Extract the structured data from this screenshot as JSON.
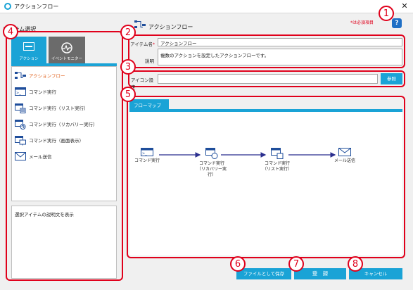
{
  "window": {
    "title": "アクションフロー"
  },
  "required_note": "*は必須項目",
  "help": {
    "label": "?"
  },
  "left": {
    "section_title": "アイテム選択",
    "tabs": [
      {
        "label": "アクション"
      },
      {
        "label": "イベントモニター"
      }
    ],
    "items": [
      {
        "label": "アクションフロー",
        "icon": "action-flow-icon"
      },
      {
        "label": "コマンド実行",
        "icon": "command-icon"
      },
      {
        "label": "コマンド実行（リスト実行）",
        "icon": "command-list-icon"
      },
      {
        "label": "コマンド実行（リカバリー実行）",
        "icon": "command-recovery-icon"
      },
      {
        "label": "コマンド実行（画面表示）",
        "icon": "command-display-icon"
      },
      {
        "label": "メール送信",
        "icon": "mail-icon"
      }
    ],
    "description": "選択アイテムの説明文を表示"
  },
  "header": {
    "title": "アクションフロー"
  },
  "form": {
    "item_name_label": "アイテム名",
    "item_name_value": "アクションフロー",
    "description_label": "説明",
    "description_value": "複数のアクションを設定したアクションフローです。",
    "icon_label": "アイコン設定",
    "icon_value": "",
    "browse_label": "参照"
  },
  "flow": {
    "tab_label": "フローマップ",
    "nodes": [
      {
        "label": "コマンド実行"
      },
      {
        "label": "コマンド実行（リカバリー実行）"
      },
      {
        "label": "コマンド実行（リスト実行）"
      },
      {
        "label": "メール送信"
      }
    ]
  },
  "buttons": {
    "save_file": "ファイルとして保存",
    "register": "登　録",
    "cancel": "キャンセル"
  },
  "badges": [
    "1",
    "2",
    "3",
    "4",
    "5",
    "6",
    "7",
    "8"
  ],
  "colors": {
    "accent": "#1aa3d6",
    "annotation": "#e0001b",
    "arrow": "#2b2f8f"
  }
}
